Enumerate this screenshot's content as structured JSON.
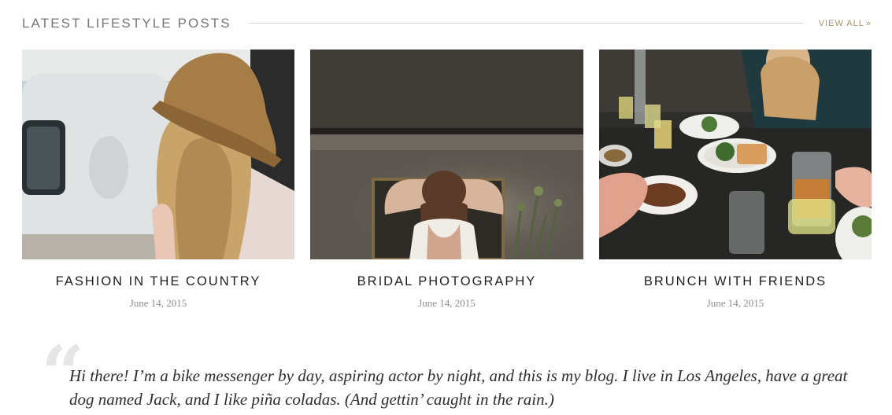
{
  "section": {
    "title": "LATEST LIFESTYLE POSTS",
    "view_all_label": "VIEW ALL",
    "view_all_icon": "double-chevron-right-icon",
    "accent_color": "#a89568"
  },
  "posts": [
    {
      "title": "FASHION IN THE COUNTRY",
      "date": "June 14, 2015",
      "image": "woman-in-straw-hat-photo"
    },
    {
      "title": "BRIDAL PHOTOGRAPHY",
      "date": "June 14, 2015",
      "image": "bride-adjusting-hair-photo"
    },
    {
      "title": "BRUNCH WITH FRIENDS",
      "date": "June 14, 2015",
      "image": "brunch-table-photo"
    }
  ],
  "quote": {
    "icon": "quote-mark-icon",
    "text": "Hi there! I’m a bike messenger by day, aspiring actor by night, and this is my blog. I live in Los Angeles, have a great dog named Jack, and I like piña coladas. (And gettin’ caught in the rain.)"
  }
}
